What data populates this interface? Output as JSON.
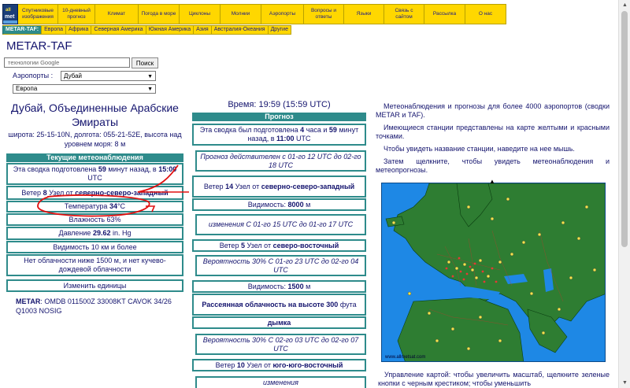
{
  "logo": {
    "line1": "all",
    "line2": "met"
  },
  "nav": [
    {
      "label": "Спутниковые изображения",
      "w": 0
    },
    {
      "label": "10-дневный прогноз"
    },
    {
      "label": "Климат"
    },
    {
      "label": "Погода в море"
    },
    {
      "label": "Циклоны"
    },
    {
      "label": "Молнии"
    },
    {
      "label": "Аэропорты"
    },
    {
      "label": "Вопросы и ответы"
    },
    {
      "label": "Языки"
    },
    {
      "label": "Связь с сайтом"
    },
    {
      "label": "Рассылка"
    },
    {
      "label": "О нас"
    }
  ],
  "regions": [
    "METAR-TAF:",
    "Европа",
    "Африка",
    "Северная Америка",
    "Южная Америка",
    "Азия",
    "Австралия-Океания",
    "Другие"
  ],
  "page_title": "METAR-TAF",
  "search": {
    "placeholder": "технологии Google",
    "button": "Поиск"
  },
  "airport": {
    "label": "Аэропорты :",
    "selected": "Дубай"
  },
  "region_select": {
    "selected": "Европа"
  },
  "station": {
    "city": "Дубай, Объединенные Арабские Эмираты",
    "coords": "широта: 25-15-10N, долгота: 055-21-52E, высота над уровнем моря: 8 м",
    "header": "Текущие метеонаблюдения",
    "obs_time_pre": "Эта сводка подготовлена ",
    "obs_time_min": "59",
    "obs_time_mid": " минут назад, в ",
    "obs_time_utc": "15:00",
    "obs_time_post": " UTC",
    "wind_pre": "Ветер ",
    "wind_kt": "8",
    "wind_mid": " Узел от ",
    "wind_dir": "северно-северо-западный",
    "temp_pre": "Температура ",
    "temp_val": "34",
    "temp_post": "°C",
    "humidity": "Влажность 63%",
    "pressure_pre": "Давление ",
    "pressure_val": "29.62",
    "pressure_post": " in. Hg",
    "visibility": "Видимость 10 км и более",
    "clouds": "Нет облачности ниже 1500 м, и нет кучево-дождевой облачности",
    "change_units": "Изменить единицы",
    "metar_label": "METAR",
    "metar_text": ": OMDB 011500Z 33008KT CAVOK 34/26 Q1003 NOSIG"
  },
  "forecast": {
    "time_label": "Время: 19:59 (15:59 UTC)",
    "header": "Прогноз",
    "issued_pre": "Эта сводка был подготовлена ",
    "issued_h": "4",
    "issued_mid": " часа и ",
    "issued_m": "59",
    "issued_mid2": " минут назад, в ",
    "issued_utc": "11:00",
    "issued_post": " UTC",
    "valid": "Прогноз действителен с 01-го 12 UTC до 02-го 18 UTC",
    "wind1_pre": "Ветер ",
    "wind1_kt": "14",
    "wind1_mid": " Узел от ",
    "wind1_dir": "северно-северо-западный",
    "vis1_pre": "Видимость: ",
    "vis1_val": "8000",
    "vis1_post": " м",
    "change1": "изменения С 01-го 15 UTC до 01-го 17 UTC",
    "wind2_pre": "Ветер ",
    "wind2_kt": "5",
    "wind2_mid": " Узел от ",
    "wind2_dir": "северо-восточный",
    "prob1": "Вероятность 30% С 01-го 23 UTC до 02-го 04 UTC",
    "vis2_pre": "Видимость: ",
    "vis2_val": "1500",
    "vis2_post": " м",
    "cloud_pre": "Рассеянная облачность на высоте ",
    "cloud_val": "300",
    "cloud_post": " фута",
    "haze": "дымка",
    "prob2": "Вероятность 30% С 02-го 03 UTC до 02-го 07 UTC",
    "wind3_pre": "Ветер ",
    "wind3_kt": "10",
    "wind3_mid": " Узел от ",
    "wind3_dir": "юго-юго-восточный",
    "change2": "изменения"
  },
  "info": {
    "p1": "Метеонаблюдения и прогнозы для более 4000 аэропортов (сводки METAR и TAF).",
    "p2": "Имеющиеся станции представлены на карте желтыми и красными точками.",
    "p3": "Чтобы увидеть название станции, наведите на нее мышь.",
    "p4": "Затем щелкните, чтобы увидеть метеонаблюдения и метеопрогнозы.",
    "map_url": "www.allmetsat.com",
    "caption": "Управление картой: чтобы увеличить масштаб, щелкните зеленые кнопки с черным крестиком; чтобы уменьшить"
  },
  "colors": {
    "teal": "#2e8b8b",
    "yellow": "#ffd700",
    "navy": "#14146e",
    "sea": "#1e88e5",
    "land": "#2e7d32",
    "annotation": "#e01010"
  }
}
